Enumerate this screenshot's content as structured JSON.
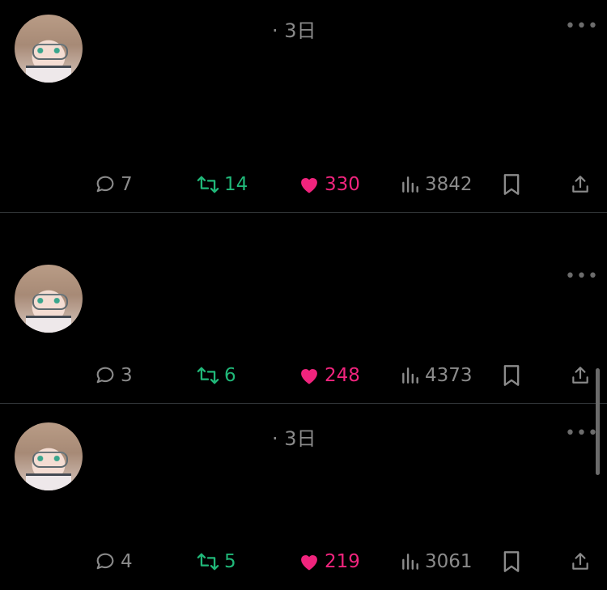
{
  "posts": [
    {
      "time": "· 3日",
      "replies": "7",
      "retweets": "14",
      "likes": "330",
      "views": "3842"
    },
    {
      "time": "",
      "replies": "3",
      "retweets": "6",
      "likes": "248",
      "views": "4373"
    },
    {
      "time": "· 3日",
      "replies": "4",
      "retweets": "5",
      "likes": "219",
      "views": "3061"
    }
  ],
  "more_label": "•••",
  "colors": {
    "background": "#000000",
    "retweet": "#20b879",
    "like": "#f0247d",
    "muted": "#8b8b8b",
    "divider": "#2f3336"
  },
  "icons": [
    "reply-icon",
    "retweet-icon",
    "heart-icon",
    "views-icon",
    "bookmark-icon",
    "share-icon",
    "more-icon"
  ]
}
